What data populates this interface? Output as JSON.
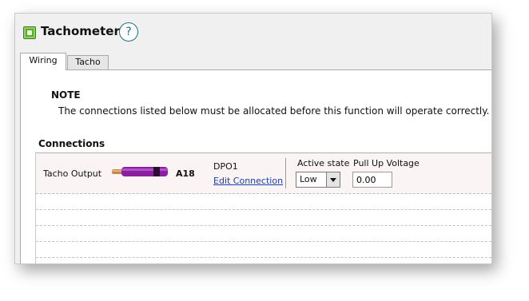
{
  "window": {
    "title": "Tachometer",
    "help_glyph": "?"
  },
  "tabs": [
    {
      "label": "Wiring",
      "active": true
    },
    {
      "label": "Tacho",
      "active": false
    }
  ],
  "note": {
    "title": "NOTE",
    "text": "The connections listed below must be allocated before this function will operate correctly."
  },
  "connections": {
    "heading": "Connections",
    "row": {
      "name": "Tacho Output",
      "wire_icon": "purple-wire-icon",
      "pin": "A18",
      "channel": "DPO1",
      "edit_link": "Edit Connection",
      "active_state_label": "Active state",
      "active_state_value": "Low",
      "pullup_label": "Pull Up Voltage",
      "pullup_value": "0.00"
    }
  },
  "colors": {
    "accent": "#5faa35",
    "link": "#1a3fa8",
    "help": "#1f6f7a",
    "wire": "#8a1fa0"
  }
}
